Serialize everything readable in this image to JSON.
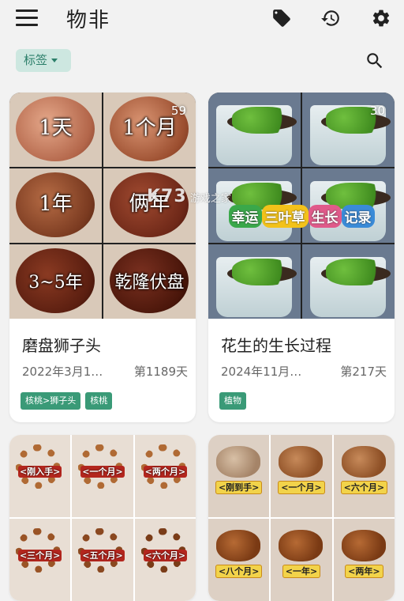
{
  "app": {
    "title": "物非"
  },
  "filter": {
    "chip_label": "标签"
  },
  "icons": {
    "menu": "menu-icon",
    "tag": "tag-icon",
    "history": "history-icon",
    "settings": "gear-icon",
    "search": "search-icon",
    "caret": "caret-down-icon"
  },
  "cards": [
    {
      "title": "磨盘狮子头",
      "date": "2022年3月1…",
      "days": "第1189天",
      "count": "59",
      "tags": [
        "核桃>狮子头",
        "核桃"
      ],
      "stages": [
        "1天",
        "1个月",
        "1年",
        "俩年",
        "3~5年",
        "乾隆伏盘"
      ]
    },
    {
      "title": "花生的生长过程",
      "date": "2024年11月…",
      "days": "第217天",
      "count": "30",
      "tags": [
        "植物"
      ],
      "banner": [
        "幸运",
        "三叶草",
        "生长",
        "记录"
      ]
    },
    {
      "stages": [
        "<刚入手>",
        "<一个月>",
        "<两个月>",
        "<三个月>",
        "<五个月>",
        "<六个月>"
      ]
    },
    {
      "stages": [
        "<刚到手>",
        "<一个月>",
        "<六个月>",
        "<八个月>",
        "<一年>",
        "<两年>"
      ]
    }
  ],
  "watermark": {
    "brand": "K73",
    "text": "游戏之家"
  },
  "colors": {
    "accent": "#3a9a77",
    "chip_bg": "#cde7e0",
    "background": "#f2f2f2"
  }
}
